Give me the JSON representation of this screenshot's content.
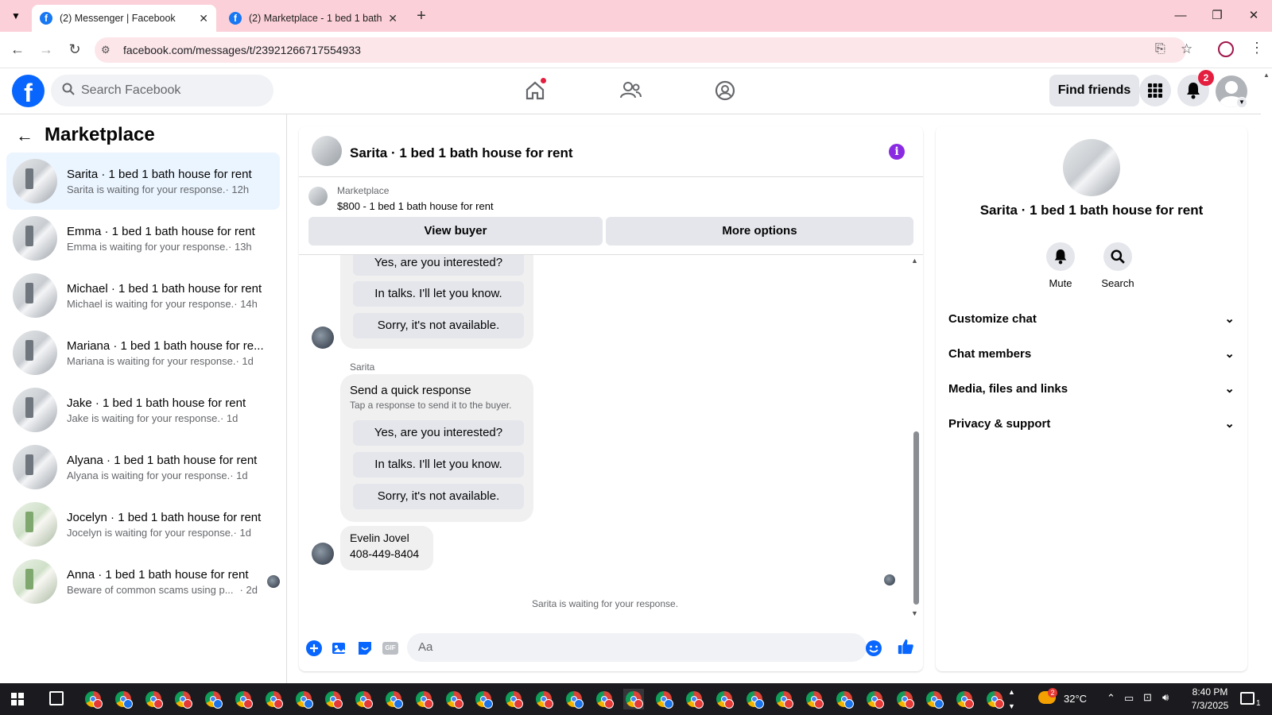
{
  "browser": {
    "tabs": [
      {
        "title": "(2) Messenger | Facebook",
        "active": true
      },
      {
        "title": "(2) Marketplace - 1 bed 1 bath",
        "active": false
      }
    ],
    "url": "facebook.com/messages/t/23921266717554933"
  },
  "fb_header": {
    "search_placeholder": "Search Facebook",
    "find_friends": "Find friends",
    "notification_count": "2"
  },
  "sidebar": {
    "title": "Marketplace",
    "conversations": [
      {
        "name": "Sarita · 1 bed 1 bath house for rent",
        "preview": "Sarita is waiting for your response.",
        "time": "· 12h",
        "selected": true
      },
      {
        "name": "Emma · 1 bed 1 bath house for rent",
        "preview": "Emma is waiting for your response.",
        "time": "· 13h"
      },
      {
        "name": "Michael · 1 bed 1 bath house for rent",
        "preview": "Michael is waiting for your response.",
        "time": "· 14h"
      },
      {
        "name": "Mariana · 1 bed 1 bath house for re...",
        "preview": "Mariana is waiting for your response.",
        "time": "· 1d"
      },
      {
        "name": "Jake · 1 bed 1 bath house for rent",
        "preview": "Jake is waiting for your response.",
        "time": "· 1d"
      },
      {
        "name": "Alyana · 1 bed 1 bath house for rent",
        "preview": "Alyana is waiting for your response.",
        "time": "· 1d"
      },
      {
        "name": "Jocelyn · 1 bed 1 bath house for rent",
        "preview": "Jocelyn is waiting for your response.",
        "time": "· 1d"
      },
      {
        "name": "Anna · 1 bed 1 bath house for rent",
        "preview": "Beware of common scams using p...",
        "time": "· 2d"
      }
    ]
  },
  "chat": {
    "title": "Sarita · 1 bed 1 bath house for rent",
    "marketplace_label": "Marketplace",
    "listing": "$800 - 1 bed 1 bath house for rent",
    "view_buyer": "View buyer",
    "more_options": "More options",
    "quick_replies": [
      "Yes, are you interested?",
      "In talks. I'll let you know.",
      "Sorry, it's not available."
    ],
    "sender_label": "Sarita",
    "quick_title": "Send a quick response",
    "quick_sub": "Tap a response to send it to the buyer.",
    "contact_name": "Evelin Jovel",
    "contact_phone": "408-449-8404",
    "waiting_note": "Sarita is waiting for your response.",
    "composer_placeholder": "Aa"
  },
  "details": {
    "title": "Sarita · 1 bed 1 bath house for rent",
    "mute": "Mute",
    "search": "Search",
    "sections": [
      "Customize chat",
      "Chat members",
      "Media, files and links",
      "Privacy & support"
    ]
  },
  "taskbar": {
    "temp": "32°C",
    "weather_badge": "2",
    "time": "8:40 PM",
    "date": "7/3/2025",
    "notif_count": "1"
  },
  "colors": {
    "fb_blue": "#0866ff",
    "tab_bg": "#fbd0d8",
    "selected_row": "#ebf5ff"
  }
}
